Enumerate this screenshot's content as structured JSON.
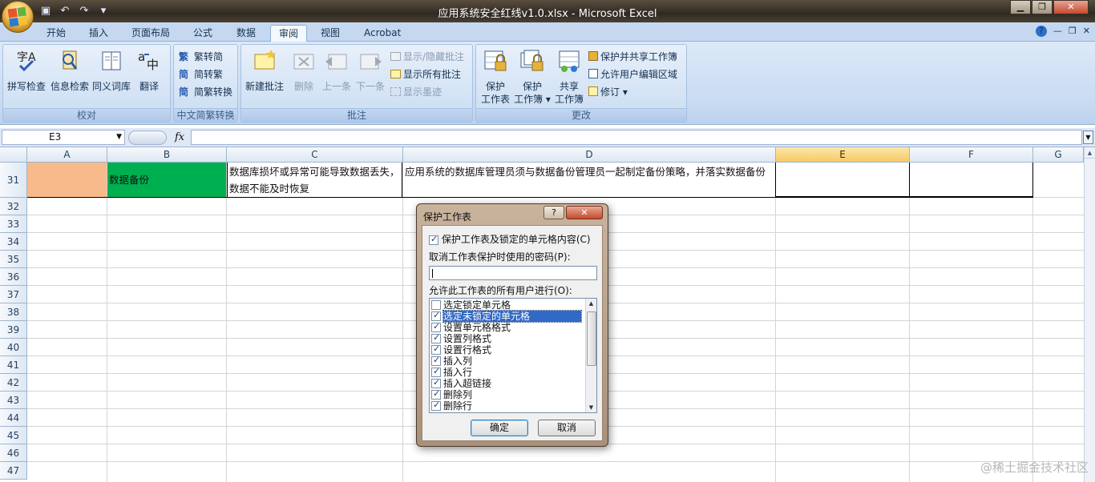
{
  "window": {
    "title": "应用系统安全红线v1.0.xlsx - Microsoft Excel",
    "controls": {
      "minimize": "▁",
      "maximize": "❐",
      "close": "✕"
    }
  },
  "qat": {
    "icons": [
      "save-icon",
      "undo-icon",
      "redo-icon",
      "customize-icon"
    ],
    "glyphs": [
      "▣",
      "↶",
      "↷",
      "▾"
    ]
  },
  "tabs": [
    "开始",
    "插入",
    "页面布局",
    "公式",
    "数据",
    "审阅",
    "视图",
    "Acrobat"
  ],
  "active_tab": "审阅",
  "tab_controls": {
    "help": "?",
    "minimize": "—",
    "restore": "❐",
    "close": "✕"
  },
  "ribbon": {
    "proofing": {
      "label": "校对",
      "buttons": [
        "拼写检查",
        "信息检索",
        "同义词库",
        "翻译"
      ]
    },
    "chinese_conversion": {
      "label": "中文简繁转换",
      "buttons": [
        "繁转简",
        "简转繁",
        "简繁转换"
      ]
    },
    "comments": {
      "label": "批注",
      "big_buttons": [
        "新建批注",
        "删除",
        "上一条",
        "下一条"
      ],
      "small_buttons": [
        "显示/隐藏批注",
        "显示所有批注",
        "显示墨迹"
      ]
    },
    "changes": {
      "label": "更改",
      "big_buttons": [
        {
          "line1": "保护",
          "line2": "工作表"
        },
        {
          "line1": "保护",
          "line2": "工作簿 ▾"
        },
        {
          "line1": "共享",
          "line2": "工作簿"
        }
      ],
      "small_buttons": [
        "保护并共享工作簿",
        "允许用户编辑区域",
        "修订 ▾"
      ]
    }
  },
  "formula_bar": {
    "name_box": "E3",
    "fx": "fx",
    "value": ""
  },
  "sheet": {
    "columns": [
      "A",
      "B",
      "C",
      "D",
      "E",
      "F",
      "G"
    ],
    "selected_column": "E",
    "rows": [
      "31",
      "32",
      "33",
      "34",
      "35",
      "36",
      "37",
      "38",
      "39",
      "40",
      "41",
      "42",
      "43",
      "44",
      "45",
      "46",
      "47"
    ],
    "row31": {
      "B": "数据备份",
      "C": "数据库损坏或异常可能导致数据丢失，数据不能及时恢复",
      "D": "应用系统的数据库管理员须与数据备份管理员一起制定备份策略，并落实数据备份"
    },
    "colors": {
      "cell_A31": "#f8b98b",
      "cell_B31": "#00b050"
    }
  },
  "dialog": {
    "title": "保护工作表",
    "help": "?",
    "close": "✕",
    "protect_checkbox_label": "保护工作表及锁定的单元格内容(C)",
    "protect_checked": true,
    "password_label": "取消工作表保护时使用的密码(P):",
    "password_value": "",
    "allow_label": "允许此工作表的所有用户进行(O):",
    "permissions": [
      {
        "label": "选定锁定单元格",
        "checked": false,
        "selected": false
      },
      {
        "label": "选定未锁定的单元格",
        "checked": true,
        "selected": true
      },
      {
        "label": "设置单元格格式",
        "checked": true,
        "selected": false
      },
      {
        "label": "设置列格式",
        "checked": true,
        "selected": false
      },
      {
        "label": "设置行格式",
        "checked": true,
        "selected": false
      },
      {
        "label": "插入列",
        "checked": true,
        "selected": false
      },
      {
        "label": "插入行",
        "checked": true,
        "selected": false
      },
      {
        "label": "插入超链接",
        "checked": true,
        "selected": false
      },
      {
        "label": "删除列",
        "checked": true,
        "selected": false
      },
      {
        "label": "删除行",
        "checked": true,
        "selected": false
      }
    ],
    "ok": "确定",
    "cancel": "取消"
  },
  "watermark": "@稀土掘金技术社区"
}
